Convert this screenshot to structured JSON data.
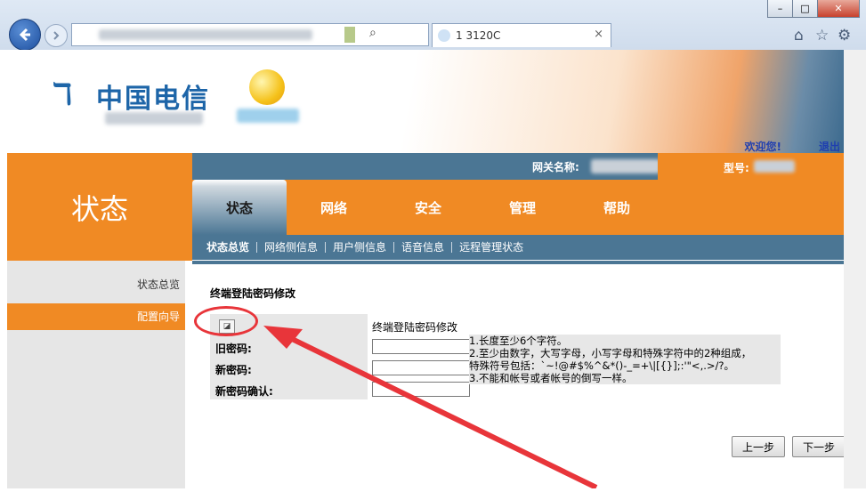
{
  "browser": {
    "tab_title": "1 3120C",
    "close_tab": "×",
    "search_glyph": "⌕",
    "win_minimize": "–",
    "win_maximize": "□",
    "win_close": "✕",
    "icons": [
      "back-icon",
      "forward-icon",
      "home-icon",
      "star-icon",
      "gear-icon"
    ]
  },
  "header": {
    "logo_text": "中国电信",
    "welcome": "欢迎您!",
    "logout": "退出"
  },
  "section_title": "状态",
  "infobar": {
    "gateway_label": "网关名称:",
    "model_label": "型号:"
  },
  "nav": {
    "tabs": [
      "状态",
      "网络",
      "安全",
      "管理",
      "帮助"
    ],
    "active": "状态"
  },
  "subnav": [
    "状态总览",
    "网络侧信息",
    "用户侧信息",
    "语音信息",
    "远程管理状态"
  ],
  "sidebar": {
    "items": [
      "状态总览",
      "配置向导"
    ],
    "active": "配置向导"
  },
  "content": {
    "title": "终端登陆密码修改",
    "form_title": "终端登陆密码修改",
    "old_password_label": "旧密码:",
    "new_password_label": "新密码:",
    "confirm_password_label": "新密码确认:",
    "rules": [
      "1.长度至少6个字符。",
      "2.至少由数字，大写字母，小写字母和特殊字符中的2种组成，",
      "特殊符号包括：`~!@#$%^&*()-_=+\\|[{}];:'\"<,.>/?。",
      "3.不能和帐号或者帐号的倒写一样。"
    ],
    "prev_button": "上一步",
    "next_button": "下一步"
  },
  "colors": {
    "orange": "#f08a24",
    "steel_blue": "#4b7694",
    "annotation_red": "#e8353a"
  }
}
